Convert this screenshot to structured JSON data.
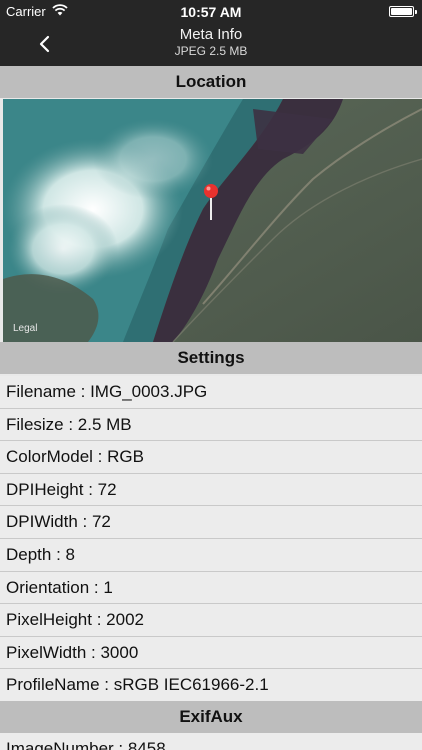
{
  "status_bar": {
    "carrier": "Carrier",
    "time": "10:57 AM"
  },
  "nav": {
    "title": "Meta Info",
    "subtitle": "JPEG 2.5 MB"
  },
  "sections": {
    "location": "Location",
    "settings": "Settings",
    "exifaux": "ExifAux"
  },
  "map": {
    "legal": "Legal"
  },
  "settings_rows": [
    "Filename : IMG_0003.JPG",
    "Filesize : 2.5 MB",
    "ColorModel : RGB",
    "DPIHeight : 72",
    "DPIWidth : 72",
    "Depth : 8",
    "Orientation : 1",
    "PixelHeight : 2002",
    "PixelWidth : 3000",
    "ProfileName : sRGB IEC61966-2.1"
  ],
  "exifaux_rows": [
    "ImageNumber : 8458"
  ],
  "colors": {
    "bar_background": "#262626",
    "section_header": "#bdbdbd",
    "row_background": "#ececec",
    "pin": "#e8322e"
  }
}
